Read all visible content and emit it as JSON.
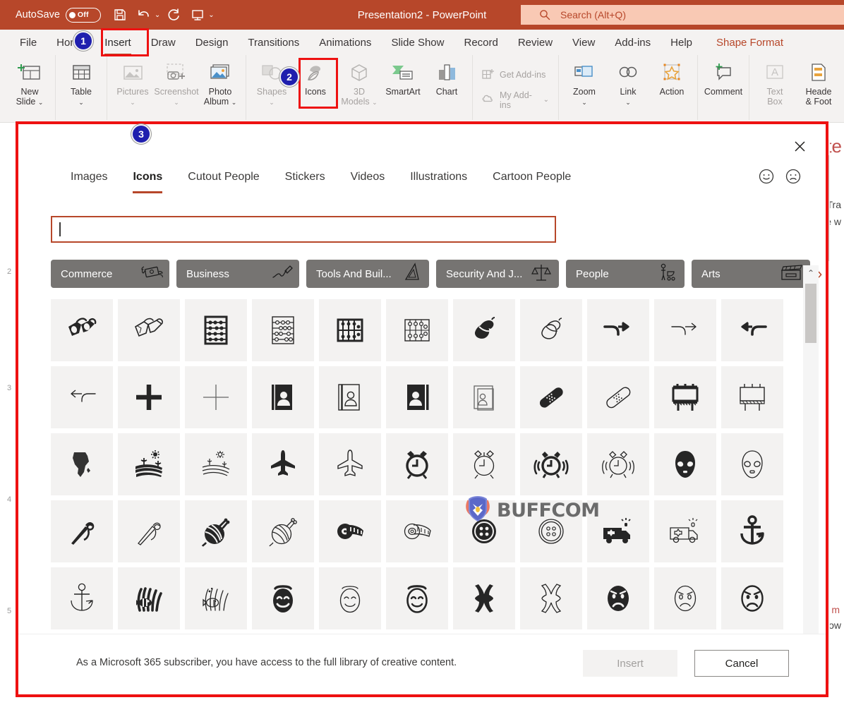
{
  "titlebar": {
    "autosave_label": "AutoSave",
    "autosave_state": "Off",
    "document_title": "Presentation2  -  PowerPoint",
    "search_placeholder": "Search (Alt+Q)",
    "qat": [
      {
        "name": "save-icon",
        "label": "Save"
      },
      {
        "name": "undo-icon",
        "label": "Undo"
      },
      {
        "name": "redo-icon",
        "label": "Redo"
      },
      {
        "name": "start-presentation-icon",
        "label": "Start From Beginning"
      },
      {
        "name": "customize-quick-access-toolbar-icon",
        "label": "Customize Quick Access Toolbar"
      }
    ]
  },
  "ribbon_tabs": [
    {
      "label": "File",
      "active": false
    },
    {
      "label": "Home",
      "active": false
    },
    {
      "label": "Insert",
      "active": true
    },
    {
      "label": "Draw",
      "active": false
    },
    {
      "label": "Design",
      "active": false
    },
    {
      "label": "Transitions",
      "active": false
    },
    {
      "label": "Animations",
      "active": false
    },
    {
      "label": "Slide Show",
      "active": false
    },
    {
      "label": "Record",
      "active": false
    },
    {
      "label": "Review",
      "active": false
    },
    {
      "label": "View",
      "active": false
    },
    {
      "label": "Add-ins",
      "active": false
    },
    {
      "label": "Help",
      "active": false
    },
    {
      "label": "Shape Format",
      "active": false
    }
  ],
  "ribbon_items": {
    "new_slide": "New\nSlide",
    "new_slide_l1": "New",
    "new_slide_l2": "Slide",
    "table": "Table",
    "pictures": "Pictures",
    "screenshot": "Screenshot",
    "photo_album_l1": "Photo",
    "photo_album_l2": "Album",
    "shapes": "Shapes",
    "icons": "Icons",
    "models_l1": "3D",
    "models_l2": "Models",
    "smartart": "SmartArt",
    "chart": "Chart",
    "get_addins": "Get Add-ins",
    "my_addins": "My Add-ins",
    "zoom": "Zoom",
    "link": "Link",
    "action": "Action",
    "comment": "Comment",
    "text_box_l1": "Text",
    "text_box_l2": "Box",
    "header_footer_l1": "Heade",
    "header_footer_l2": "& Foot"
  },
  "annotations": [
    {
      "number": "1",
      "target": "insert-tab"
    },
    {
      "number": "2",
      "target": "icons-ribbon-button"
    },
    {
      "number": "3",
      "target": "stock-images-dialog"
    }
  ],
  "dialog": {
    "close_label": "Close",
    "tabs": [
      {
        "label": "Images",
        "active": false
      },
      {
        "label": "Icons",
        "active": true
      },
      {
        "label": "Cutout People",
        "active": false
      },
      {
        "label": "Stickers",
        "active": false
      },
      {
        "label": "Videos",
        "active": false
      },
      {
        "label": "Illustrations",
        "active": false
      },
      {
        "label": "Cartoon People",
        "active": false
      }
    ],
    "feedback": [
      {
        "name": "happy-face-icon"
      },
      {
        "name": "sad-face-icon"
      }
    ],
    "search": {
      "value": "",
      "placeholder": ""
    },
    "categories": [
      {
        "label": "Commerce",
        "icon": "money-wings-icon"
      },
      {
        "label": "Business",
        "icon": "signature-icon"
      },
      {
        "label": "Tools And Buil...",
        "icon": "set-square-icon"
      },
      {
        "label": "Security And J...",
        "icon": "scales-of-justice-icon"
      },
      {
        "label": "People",
        "icon": "person-stroller-icon"
      },
      {
        "label": "Arts",
        "icon": "clapperboard-icon"
      }
    ],
    "categories_next_label": "›",
    "icons": [
      {
        "name": "3d-glasses-filled-icon"
      },
      {
        "name": "3d-glasses-outline-icon"
      },
      {
        "name": "abacus-filled-icon"
      },
      {
        "name": "abacus-outline-icon"
      },
      {
        "name": "abacus-grid-filled-icon"
      },
      {
        "name": "abacus-grid-outline-icon"
      },
      {
        "name": "acorn-filled-icon"
      },
      {
        "name": "acorn-outline-icon"
      },
      {
        "name": "arrow-turn-right-filled-icon"
      },
      {
        "name": "arrow-turn-right-outline-icon"
      },
      {
        "name": "arrow-turn-left-filled-icon"
      },
      {
        "name": "arrow-turn-left-outline-icon"
      },
      {
        "name": "plus-filled-icon"
      },
      {
        "name": "plus-outline-icon"
      },
      {
        "name": "address-book-filled-icon"
      },
      {
        "name": "address-book-outline-icon"
      },
      {
        "name": "address-book-filled-2-icon"
      },
      {
        "name": "address-book-outline-2-icon"
      },
      {
        "name": "adhesive-bandage-filled-icon"
      },
      {
        "name": "adhesive-bandage-outline-icon"
      },
      {
        "name": "advertising-billboard-filled-icon"
      },
      {
        "name": "advertising-billboard-outline-icon"
      },
      {
        "name": "africa-map-filled-icon"
      },
      {
        "name": "agriculture-field-filled-icon"
      },
      {
        "name": "agriculture-field-outline-icon"
      },
      {
        "name": "airplane-filled-icon"
      },
      {
        "name": "airplane-outline-icon"
      },
      {
        "name": "alarm-clock-filled-icon"
      },
      {
        "name": "alarm-clock-outline-icon"
      },
      {
        "name": "alarm-clock-ringing-filled-icon"
      },
      {
        "name": "alarm-clock-ringing-outline-icon"
      },
      {
        "name": "alien-filled-icon"
      },
      {
        "name": "alien-outline-icon"
      },
      {
        "name": "needle-thread-filled-icon"
      },
      {
        "name": "needle-thread-outline-icon"
      },
      {
        "name": "yarn-ball-filled-icon"
      },
      {
        "name": "yarn-ball-outline-icon"
      },
      {
        "name": "measuring-tape-filled-icon"
      },
      {
        "name": "measuring-tape-outline-icon"
      },
      {
        "name": "button-filled-icon"
      },
      {
        "name": "button-outline-icon"
      },
      {
        "name": "ambulance-filled-icon"
      },
      {
        "name": "ambulance-outline-icon"
      },
      {
        "name": "anchor-filled-icon"
      },
      {
        "name": "anchor-outline-icon"
      },
      {
        "name": "anemone-fish-filled-icon"
      },
      {
        "name": "anemone-fish-outline-icon"
      },
      {
        "name": "angel-face-filled-icon"
      },
      {
        "name": "angel-face-outline-icon"
      },
      {
        "name": "angel-face-outline-2-icon"
      },
      {
        "name": "anger-symbol-filled-icon"
      },
      {
        "name": "anger-symbol-outline-icon"
      },
      {
        "name": "angry-face-filled-icon"
      },
      {
        "name": "angry-face-outline-icon"
      },
      {
        "name": "angry-face-outline-2-icon"
      }
    ],
    "scrollbar": {
      "up_label": "⌃",
      "down_label": "⌄"
    },
    "footer_note": "As a Microsoft 365 subscriber, you have access to the full library of creative content.",
    "insert_label": "Insert",
    "cancel_label": "Cancel"
  },
  "watermark": {
    "text": "BUFFCOM",
    "logo": "bull-shield-logo"
  },
  "colors": {
    "titlebar": "#b7472a",
    "accent": "#b7472a",
    "annotation_red": "#ee1111",
    "badge_blue": "#1f1fae",
    "chip_gray": "#767472",
    "cell_gray": "#f3f2f1"
  },
  "background_slide": {
    "fragments": [
      "te",
      "Tra",
      "e w",
      "m",
      "ow"
    ]
  }
}
